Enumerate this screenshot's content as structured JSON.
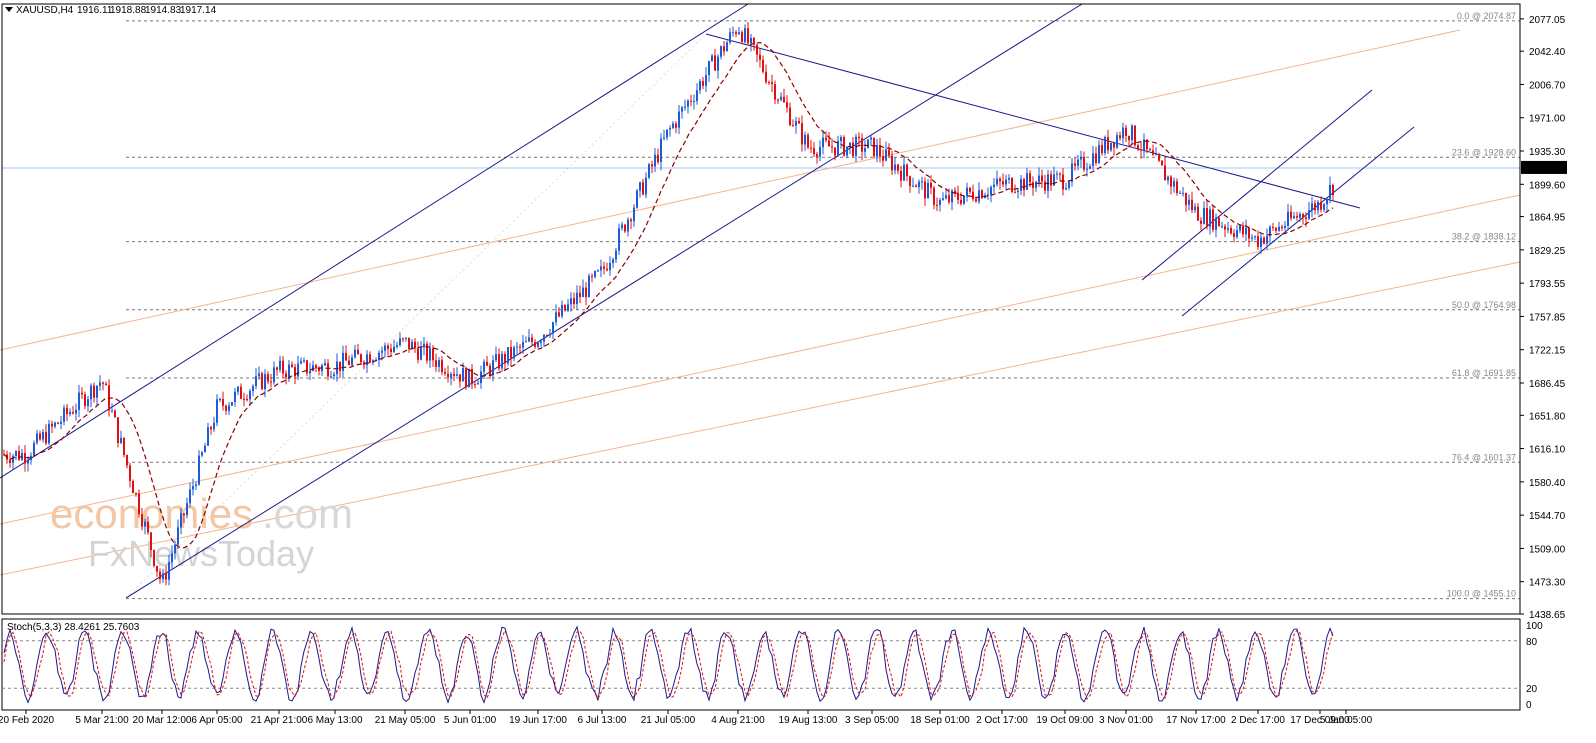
{
  "header": {
    "symbol": "XAUUSD,H4",
    "open": "1916.11",
    "high": "1918.88",
    "low": "1914.83",
    "close": "1917.14"
  },
  "stoch": {
    "label": "Stoch(5,3,3) 28.4261 25.7603",
    "levels": [
      "100",
      "80",
      "20",
      "0"
    ]
  },
  "current_price_label": "1917.14",
  "watermark": {
    "line1a": "economies",
    "line1b": ".com",
    "line2": "FxNewsToday"
  },
  "colors": {
    "background": "#ffffff",
    "bull_candle": "#1e5bd6",
    "bear_candle": "#e01010",
    "moving_average": "#8b0000",
    "trend_lines": "#1a1a8c",
    "fib_fan": "#f5b48a",
    "stoch_main": "#1a1a8c",
    "stoch_signal": "#e01010",
    "price_line": "#a8c8e8"
  },
  "chart_data": {
    "type": "candlestick",
    "timeframe": "H4",
    "ylim": [
      1438.65,
      2093.0
    ],
    "y_ticks": [
      "2077.05",
      "2042.40",
      "2006.70",
      "1971.00",
      "1935.30",
      "1899.60",
      "1864.95",
      "1829.25",
      "1793.55",
      "1757.85",
      "1722.15",
      "1686.45",
      "1651.80",
      "1616.10",
      "1580.40",
      "1544.70",
      "1509.00",
      "1473.30",
      "1438.65"
    ],
    "x_ticks": [
      "20 Feb 2020",
      "5 Mar 21:00",
      "20 Mar 12:00",
      "6 Apr 05:00",
      "21 Apr 21:00",
      "6 May 13:00",
      "21 May 05:00",
      "5 Jun 01:00",
      "19 Jun 17:00",
      "6 Jul 13:00",
      "21 Jul 05:00",
      "4 Aug 21:00",
      "19 Aug 13:00",
      "3 Sep 05:00",
      "18 Sep 01:00",
      "2 Oct 17:00",
      "19 Oct 09:00",
      "3 Nov 01:00",
      "17 Nov 17:00",
      "2 Dec 17:00",
      "17 Dec 09:00",
      "5 Jan 05:00"
    ],
    "fib_levels": [
      {
        "label": "0.0 @ 2074.87",
        "value": 2074.87
      },
      {
        "label": "23.6 @ 1928.60",
        "value": 1928.6
      },
      {
        "label": "38.2 @ 1838.12",
        "value": 1838.12
      },
      {
        "label": "50.0 @ 1764.98",
        "value": 1764.98
      },
      {
        "label": "61.8 @ 1691.85",
        "value": 1691.85
      },
      {
        "label": "76.4 @ 1601.37",
        "value": 1601.37
      },
      {
        "label": "100.0 @ 1455.10",
        "value": 1455.1
      }
    ],
    "price_path": [
      {
        "x": "20 Feb 2020",
        "y": 1610
      },
      {
        "x": "5 Mar 21:00",
        "y": 1690
      },
      {
        "x": "20 Mar 12:00",
        "y": 1470
      },
      {
        "x": "6 Apr 05:00",
        "y": 1660
      },
      {
        "x": "21 Apr 21:00",
        "y": 1700
      },
      {
        "x": "6 May 13:00",
        "y": 1705
      },
      {
        "x": "21 May 05:00",
        "y": 1730
      },
      {
        "x": "5 Jun 01:00",
        "y": 1690
      },
      {
        "x": "19 Jun 17:00",
        "y": 1735
      },
      {
        "x": "6 Jul 13:00",
        "y": 1805
      },
      {
        "x": "21 Jul 05:00",
        "y": 1955
      },
      {
        "x": "4 Aug 21:00",
        "y": 2070
      },
      {
        "x": "19 Aug 13:00",
        "y": 1940
      },
      {
        "x": "3 Sep 05:00",
        "y": 1940
      },
      {
        "x": "18 Sep 01:00",
        "y": 1880
      },
      {
        "x": "2 Oct 17:00",
        "y": 1900
      },
      {
        "x": "19 Oct 09:00",
        "y": 1905
      },
      {
        "x": "3 Nov 01:00",
        "y": 1960
      },
      {
        "x": "17 Nov 17:00",
        "y": 1870
      },
      {
        "x": "2 Dec 17:00",
        "y": 1840
      },
      {
        "x": "17 Dec 09:00",
        "y": 1880
      },
      {
        "x": "5 Jan 05:00",
        "y": 1917.14
      }
    ],
    "stoch_ylim": [
      0,
      100
    ]
  }
}
